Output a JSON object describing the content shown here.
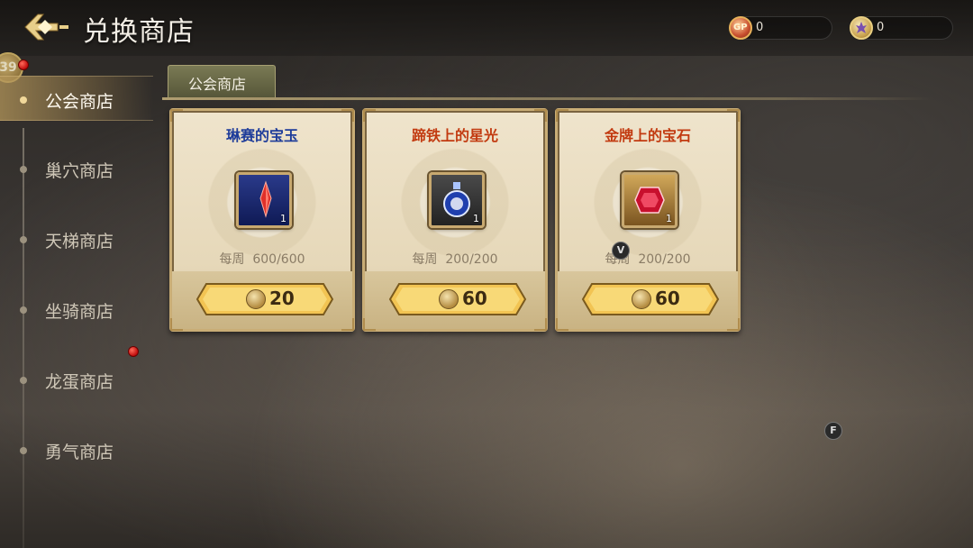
{
  "header": {
    "title": "兑换商店"
  },
  "currencies": [
    {
      "name": "gp",
      "icon": "gp-coin-icon",
      "value": "0",
      "icon_text": "GP"
    },
    {
      "name": "guild-coin",
      "icon": "guild-coin-icon",
      "value": "0"
    }
  ],
  "sidebar": {
    "level": "39",
    "items": [
      {
        "label": "公会商店",
        "active": true
      },
      {
        "label": "巢穴商店"
      },
      {
        "label": "天梯商店"
      },
      {
        "label": "坐骑商店"
      },
      {
        "label": "龙蛋商店"
      },
      {
        "label": "勇气商店"
      }
    ]
  },
  "tabs": [
    {
      "label": "公会商店"
    }
  ],
  "cards": [
    {
      "name": "琳赛的宝玉",
      "name_color": "#1e3c9a",
      "quantity": "1",
      "limit_label": "每周",
      "limit": "600/600",
      "price": "20",
      "icon": "red-crystal-icon"
    },
    {
      "name": "蹄铁上的星光",
      "name_color": "#c23a10",
      "quantity": "1",
      "limit_label": "每周",
      "limit": "200/200",
      "price": "60",
      "icon": "star-potion-icon"
    },
    {
      "name": "金牌上的宝石",
      "name_color": "#c23a10",
      "quantity": "1",
      "limit_label": "每周",
      "limit": "200/200",
      "price": "60",
      "icon": "red-gem-icon"
    }
  ],
  "overlay_keys": {
    "v": "V",
    "f": "F"
  }
}
